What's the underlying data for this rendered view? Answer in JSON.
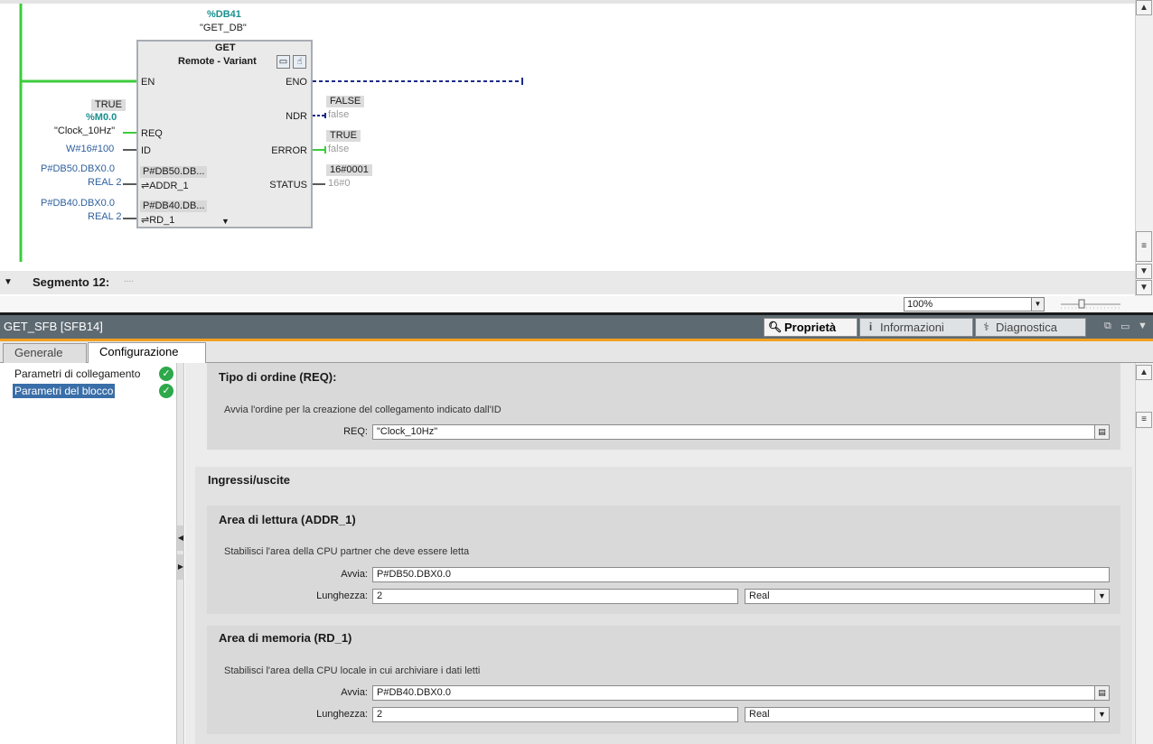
{
  "ladder": {
    "instance_db": "%DB41",
    "instance_name": "\"GET_DB\"",
    "block_title": "GET",
    "block_subtitle": "Remote - Variant",
    "pins_in": {
      "en": "EN",
      "req": "REQ",
      "id": "ID",
      "addr_value_short": "P#DB50.DB...",
      "addr": "⇌ADDR_1",
      "rd_value_short": "P#DB40.DB...",
      "rd": "⇌RD_1"
    },
    "pins_out": {
      "eno": "ENO",
      "ndr": "NDR",
      "error": "ERROR",
      "status": "STATUS"
    },
    "req_operand": {
      "state": "TRUE",
      "address": "%M0.0",
      "name": "\"Clock_10Hz\""
    },
    "id_operand": "W#16#100",
    "addr_operand": {
      "address": "P#DB50.DBX0.0",
      "type": "REAL 2"
    },
    "rd_operand": {
      "address": "P#DB40.DBX0.0",
      "type": "REAL 2"
    },
    "ndr_value": {
      "state": "FALSE",
      "value": "false"
    },
    "error_value": {
      "state": "TRUE",
      "value": "false"
    },
    "status_value": {
      "state": "16#0001",
      "value": "16#0"
    },
    "segment_label": "Segmento 12:",
    "segment_comment": "....",
    "zoom": "100%"
  },
  "inspector": {
    "title": "GET_SFB [SFB14]",
    "tabs": [
      {
        "label": "Proprietà",
        "icon": "magnifier-icon"
      },
      {
        "label": "Informazioni",
        "icon": "info-icon"
      },
      {
        "label": "Diagnostica",
        "icon": "diagnostics-icon"
      }
    ],
    "subtabs": [
      "Generale",
      "Configurazione"
    ],
    "nav": [
      {
        "label": "Parametri di collegamento",
        "status": "ok"
      },
      {
        "label": "Parametri del blocco",
        "status": "ok"
      }
    ],
    "req_section": {
      "title": "Tipo di ordine (REQ):",
      "description": "Avvia l'ordine per la creazione del collegamento indicato dall'ID",
      "label": "REQ:",
      "value": "\"Clock_10Hz\""
    },
    "io_title": "Ingressi/uscite",
    "read_section": {
      "title": "Area di lettura (ADDR_1)",
      "description": "Stabilisci l'area della CPU partner che deve essere letta",
      "start_label": "Avvia:",
      "start_value": "P#DB50.DBX0.0",
      "length_label": "Lunghezza:",
      "length_value": "2",
      "type_value": "Real"
    },
    "memory_section": {
      "title": "Area di memoria (RD_1)",
      "description": "Stabilisci l'area della CPU locale in cui archiviare i dati letti",
      "start_label": "Avvia:",
      "start_value": "P#DB40.DBX0.0",
      "length_label": "Lunghezza:",
      "length_value": "2",
      "type_value": "Real"
    }
  },
  "colors": {
    "accent_orange": "#f0a020",
    "power_rail": "#3ccc3c",
    "ok_green": "#2da84a",
    "title_bar": "#5e6a72"
  }
}
